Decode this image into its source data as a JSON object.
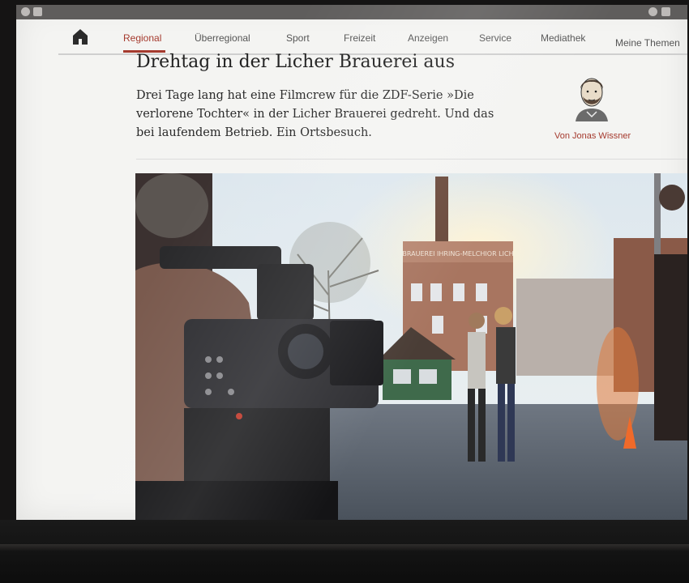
{
  "nav": {
    "items": [
      {
        "label": "Regional",
        "active": true
      },
      {
        "label": "Überregional"
      },
      {
        "label": "Sport"
      },
      {
        "label": "Freizeit"
      },
      {
        "label": "Anzeigen"
      },
      {
        "label": "Service"
      },
      {
        "label": "Mediathek"
      },
      {
        "label": "Meine Themen"
      }
    ]
  },
  "article": {
    "headline": "Drehtag in der Licher Brauerei aus",
    "lead": "Drei Tage lang hat eine Filmcrew für die ZDF-Serie »Die verlorene Tochter« in der Licher Brauerei gedreht. Und das bei laufendem Betrieb. Ein Ortsbesuch.",
    "author": "Von Jonas Wissner",
    "photo_sign": "BRAUEREI IHRING-MELCHIOR LICH"
  },
  "colors": {
    "accent": "#a53a2e",
    "statusbar": "#5f5d5c",
    "page_bg": "#f4f4f2"
  }
}
